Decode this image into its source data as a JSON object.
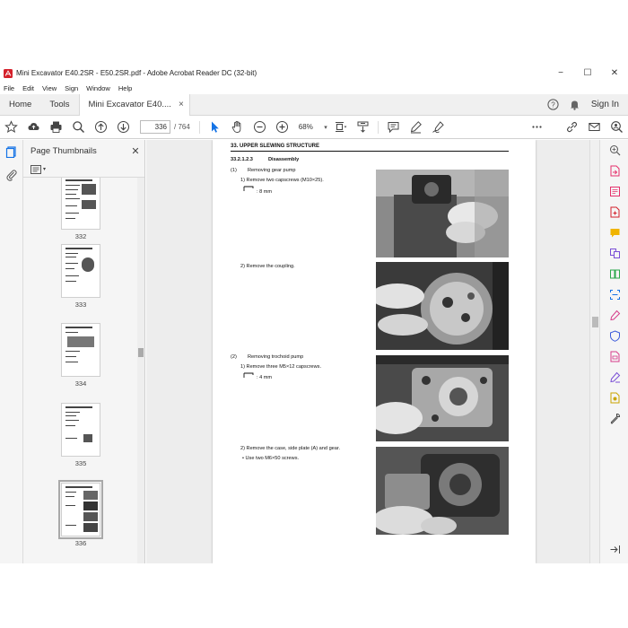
{
  "window": {
    "title": "Mini Excavator E40.2SR - E50.2SR.pdf - Adobe Acrobat Reader DC (32-bit)",
    "minimize": "−",
    "maximize": "☐",
    "close": "✕"
  },
  "menu": [
    "File",
    "Edit",
    "View",
    "Sign",
    "Window",
    "Help"
  ],
  "tabs": {
    "home": "Home",
    "tools": "Tools",
    "document": "Mini Excavator E40....",
    "close": "×",
    "signin": "Sign In"
  },
  "toolbar": {
    "current_page": "336",
    "total_pages": "/  764",
    "zoom": "68%",
    "zoom_caret": "▾"
  },
  "thumbnails": {
    "title": "Page Thumbnails",
    "close": "✕",
    "options_caret": "▾",
    "pages": [
      "332",
      "333",
      "334",
      "335",
      "336"
    ],
    "selected": "336"
  },
  "document": {
    "header": "33. UPPER SLEWING STRUCTURE",
    "section_number": "33.2.1.2.3",
    "section_title": "Disassembly",
    "step1_num": "(1)",
    "step1_title": "Removing gear pump",
    "step1_a": "1) Remove two capscrews (M10×25).",
    "step1_a_tool": ": 8 mm",
    "step1_b": "2) Remove the coupling.",
    "step2_num": "(2)",
    "step2_title": "Removing trochoid pump",
    "step2_a": "1) Remove three M5×12 capscrews.",
    "step2_a_tool": ": 4 mm",
    "step2_b": "2) Remove the case, side plate (A) and gear.",
    "step2_c": "•  Use two M6×50 screws."
  },
  "colors": {
    "acrobat_red": "#d4202a",
    "accent_blue": "#1473e6",
    "panel_bg": "#f5f5f5",
    "doc_bg": "#ededed"
  }
}
